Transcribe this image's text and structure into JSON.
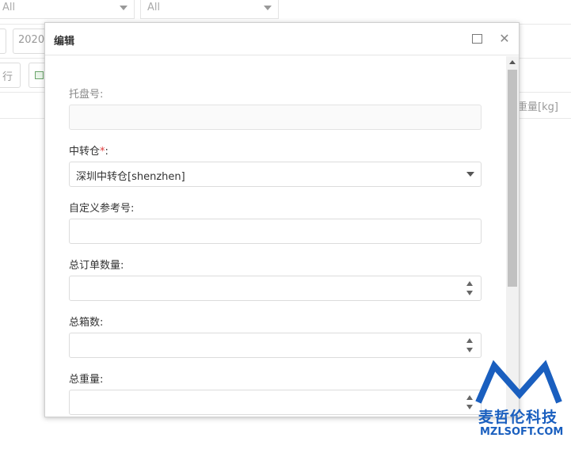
{
  "background": {
    "filter1_value": "All",
    "filter2_value": "All",
    "date_prefix": "2020",
    "row_button_text": "行",
    "column_header_weight": "重量[kg]"
  },
  "dialog": {
    "title": "编辑",
    "fields": [
      {
        "label": "托盘号:",
        "value": "",
        "type": "text",
        "disabled": true
      },
      {
        "label": "中转仓",
        "required_mark": "*",
        "label_suffix": ":",
        "value": "深圳中转仓[shenzhen]",
        "type": "select"
      },
      {
        "label": "自定义参考号:",
        "value": "",
        "type": "text"
      },
      {
        "label": "总订单数量:",
        "value": "",
        "type": "number"
      },
      {
        "label": "总箱数:",
        "value": "",
        "type": "number"
      },
      {
        "label": "总重量:",
        "value": "",
        "type": "number"
      }
    ]
  },
  "watermark": {
    "brand_cn": "麦哲伦科技",
    "brand_url": "MZLSOFT.COM",
    "color": "#1a5fbf"
  }
}
